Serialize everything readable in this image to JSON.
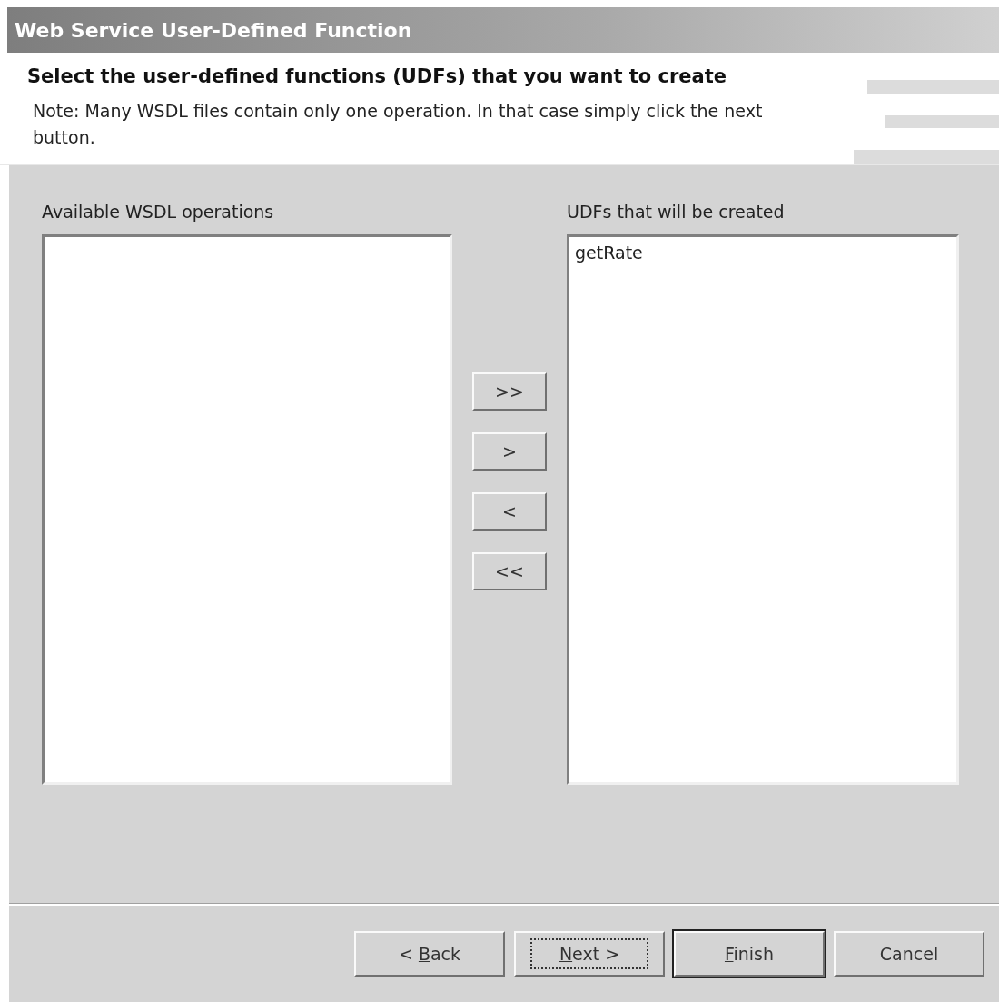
{
  "window": {
    "title": "Web Service User-Defined Function"
  },
  "header": {
    "title": "Select the user-defined functions (UDFs) that you want to create",
    "note": "Note: Many WSDL files contain only one operation. In that case simply click the next button."
  },
  "available": {
    "label": "Available WSDL operations"
  },
  "selected_list": {
    "label": "UDFs that will be created",
    "items": [
      {
        "text": "getRate",
        "selected": false
      }
    ]
  },
  "move_buttons": [
    {
      "label": ">>"
    },
    {
      "label": ">"
    },
    {
      "label": "<"
    },
    {
      "label": "<<"
    }
  ],
  "buttons": [
    {
      "before": "< ",
      "mnemonic": "B",
      "after": "ack",
      "focused": false,
      "default": false
    },
    {
      "mnemonic": "N",
      "after": "ext >",
      "focused": true,
      "default": false
    },
    {
      "mnemonic": "F",
      "after": "inish",
      "focused": false,
      "default": true
    },
    {
      "after": "Cancel",
      "focused": false,
      "default": false
    }
  ]
}
